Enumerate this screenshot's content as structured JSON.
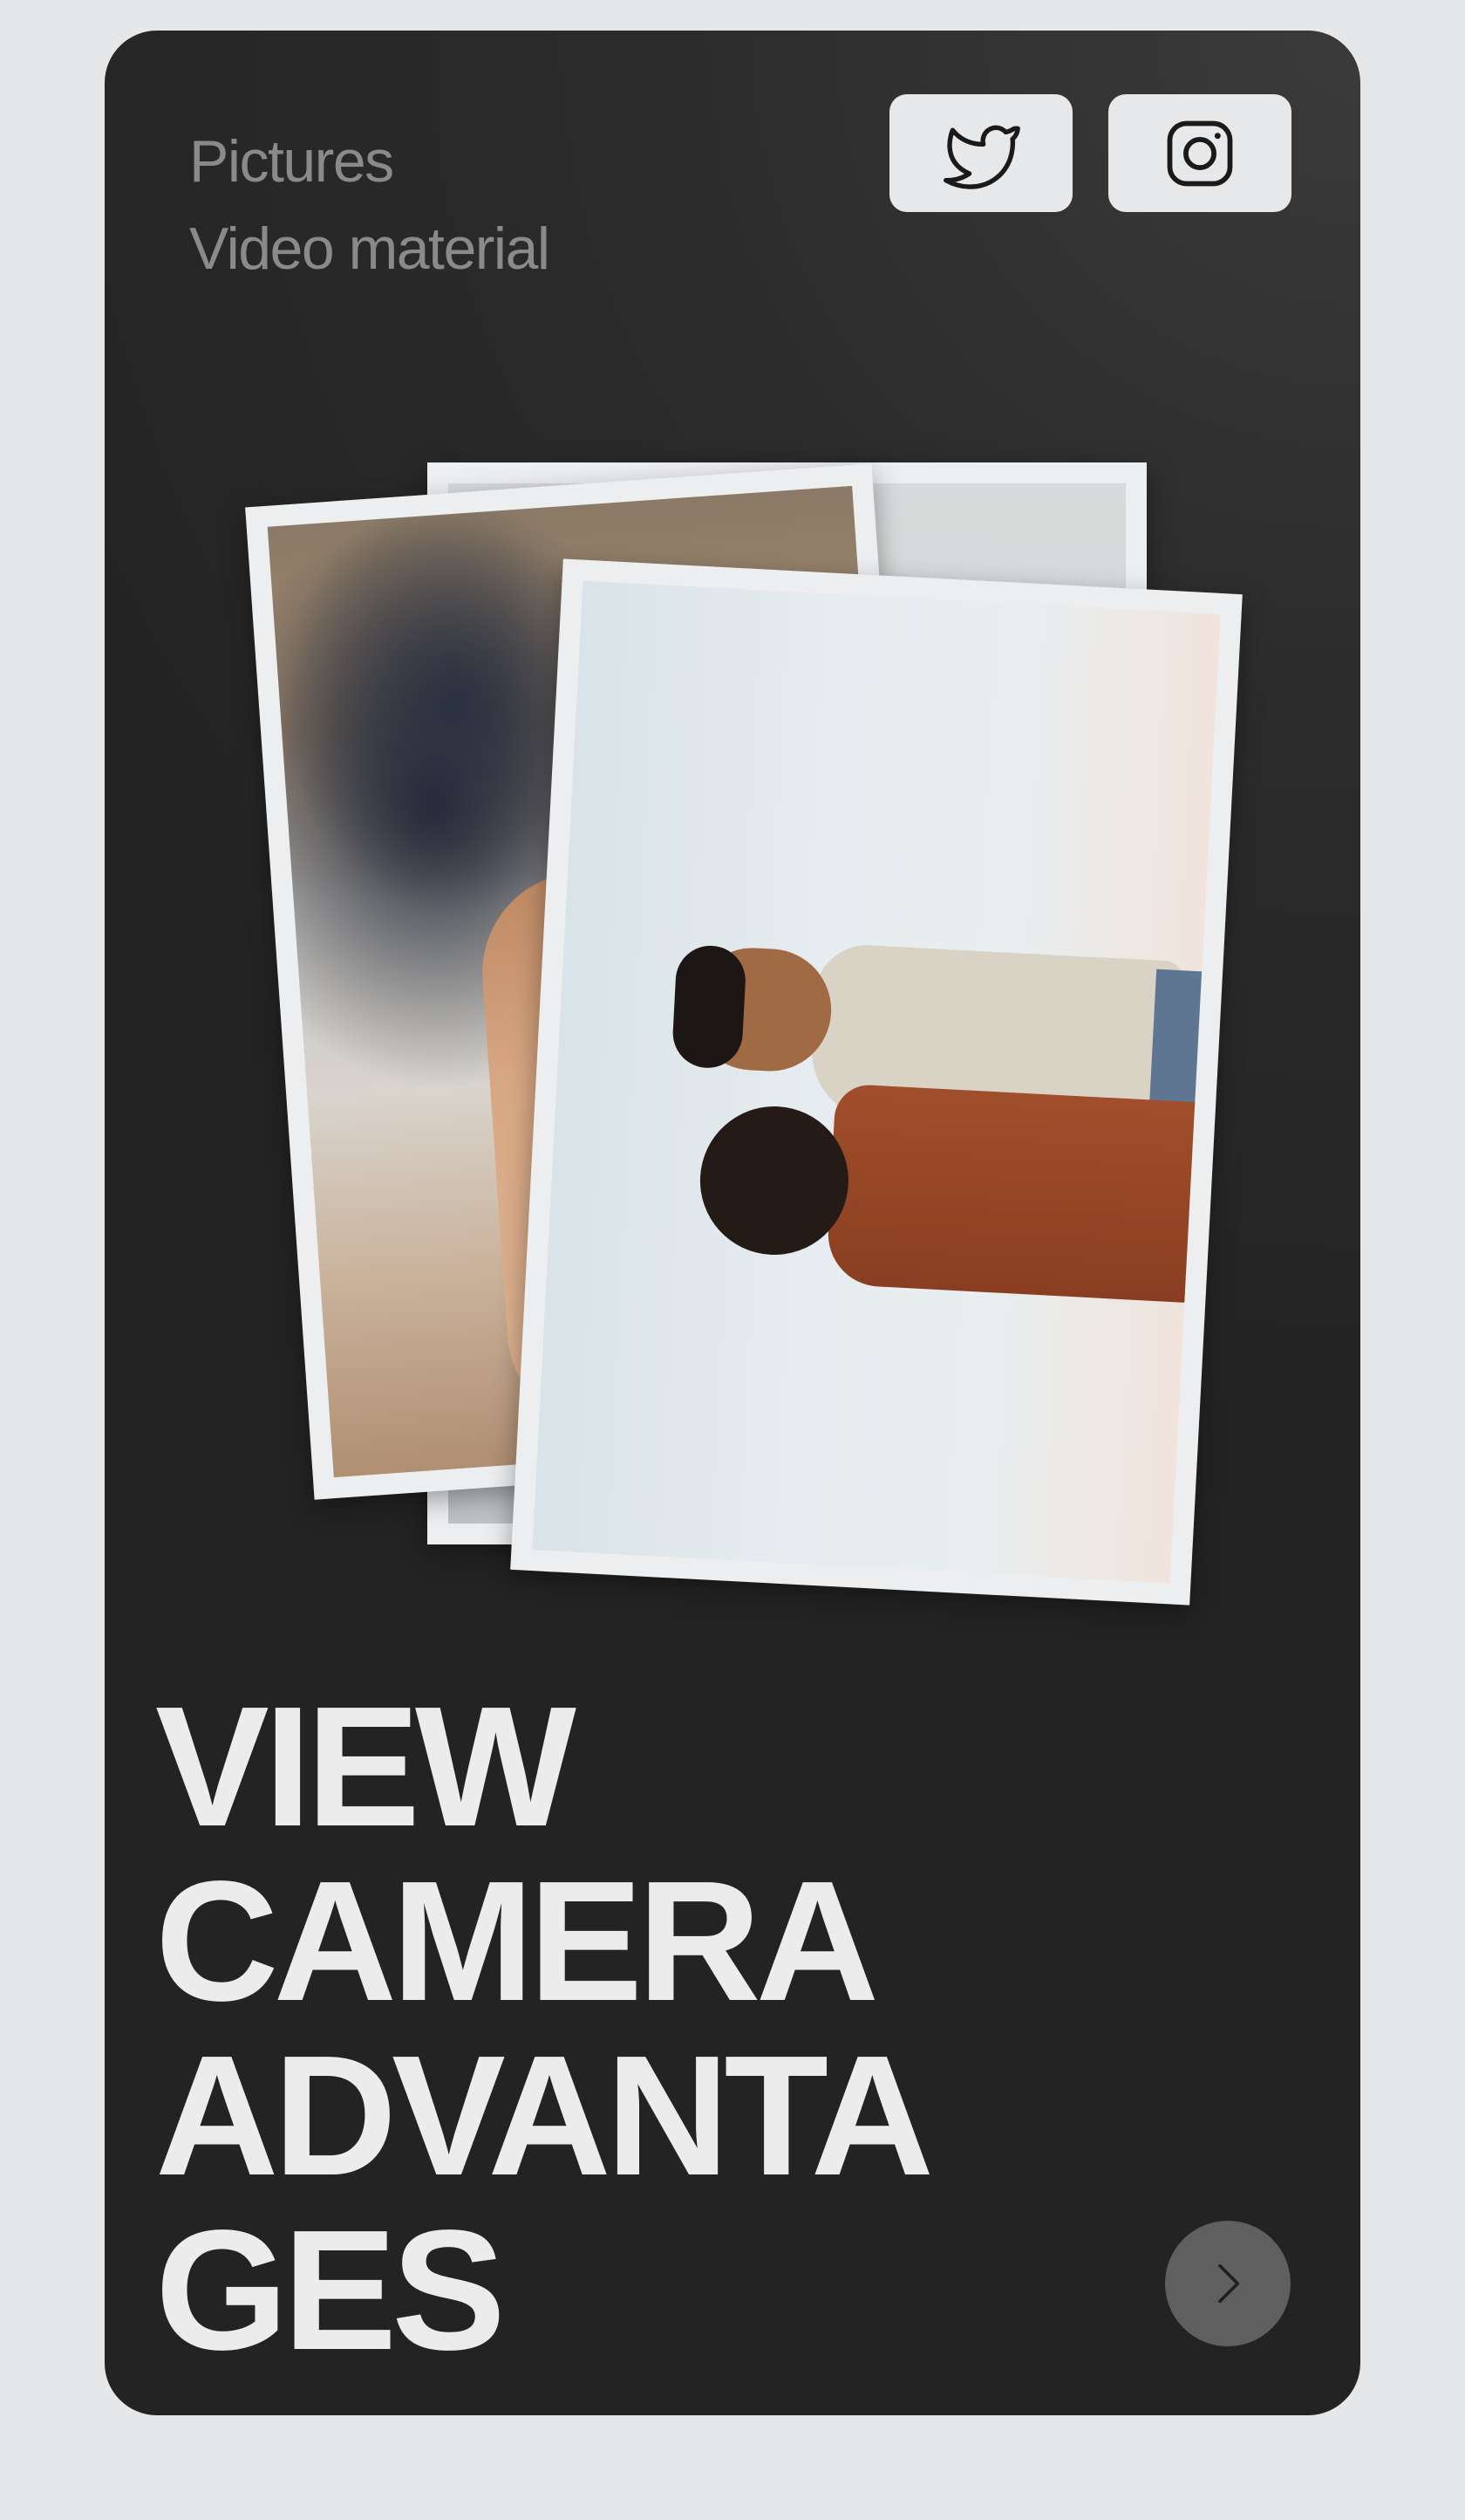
{
  "nav": {
    "items": [
      {
        "label": "Pictures"
      },
      {
        "label": "Video material"
      }
    ]
  },
  "social": {
    "twitter_icon": "twitter-icon",
    "instagram_icon": "instagram-icon"
  },
  "gallery": {
    "photos": [
      {
        "name": "photo-back",
        "subject": "beach scene (partially hidden)"
      },
      {
        "name": "photo-middle",
        "subject": "woman sunbathing on lounger"
      },
      {
        "name": "photo-front",
        "subject": "couple embracing against pale sky"
      }
    ]
  },
  "headline": {
    "lines": [
      "VIEW",
      "CAMERA",
      "ADVANTA",
      "GES"
    ]
  },
  "next_button": {
    "icon": "chevron-right-icon"
  },
  "colors": {
    "page_background": "#e6e7e9",
    "card_background": "#262626",
    "nav_text": "#8a8a8a",
    "headline_text": "#ececec",
    "social_button_bg": "#e7e8ea",
    "next_button_bg": "#5f5f5f"
  }
}
